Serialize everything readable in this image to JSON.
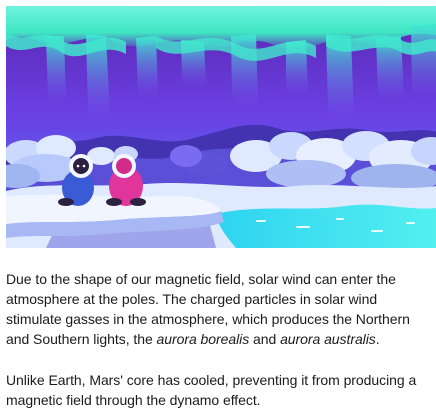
{
  "illustration": {
    "subject": "aurora-over-snowy-landscape",
    "colors": {
      "sky_top": "#5b29b6",
      "sky_mid": "#6a3ee0",
      "sky_horizon": "#4a7bf0",
      "aurora": "#3fe6c3",
      "aurora_light": "#6ff3e0",
      "snow": "#dfe9ff",
      "snow_shadow": "#9fb6f2",
      "hills": "#4a35b0",
      "ice_water": "#34d9e8",
      "figure_blue": "#3c5fd9",
      "figure_pink": "#e0379a"
    }
  },
  "article": {
    "p1_part1": "Due to the shape of our magnetic field, solar wind can enter the atmosphere at the poles. The charged particles in solar wind stimulate gasses in the atmosphere, which produces the Northern and Southern lights, the ",
    "p1_em1": "aurora borealis",
    "p1_and": " and ",
    "p1_em2": "aurora australis",
    "p1_end": ".",
    "p2": "Unlike Earth, Mars' core has cooled, preventing it from producing a magnetic field through the dynamo effect."
  }
}
